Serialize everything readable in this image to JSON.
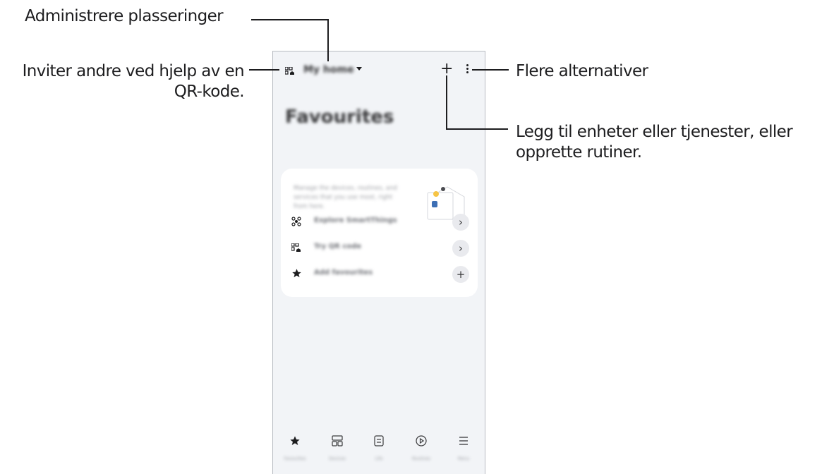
{
  "callouts": {
    "manage_locations": "Administrere plasseringer",
    "invite_line1": "Inviter andre ved hjelp av en",
    "invite_line2": "QR-kode.",
    "more_options": "Flere alternativer",
    "add_line1": "Legg til enheter eller tjenester, eller",
    "add_line2": "opprette rutiner."
  },
  "app": {
    "location_name": "My home",
    "page_title": "Favourites",
    "card_description": "Manage the devices, routines, and services that you use most, right from here.",
    "rows": [
      {
        "label": "Explore SmartThings",
        "icon": "smartthings-icon",
        "action": "chevron-right"
      },
      {
        "label": "Try QR code",
        "icon": "qr-home-icon",
        "action": "chevron-right"
      },
      {
        "label": "Add favourites",
        "icon": "star-plus-icon",
        "action": "plus"
      }
    ],
    "row_actions": {
      "chevron": "›",
      "plus": "+"
    },
    "nav": [
      {
        "label": "Favourites",
        "icon": "star-icon"
      },
      {
        "label": "Devices",
        "icon": "devices-icon"
      },
      {
        "label": "Life",
        "icon": "life-icon"
      },
      {
        "label": "Routines",
        "icon": "routines-icon"
      },
      {
        "label": "Menu",
        "icon": "menu-icon"
      }
    ],
    "top_plus": "+"
  },
  "colors": {
    "background": "#f2f4f7",
    "card": "#ffffff",
    "text": "#1d1d1f",
    "accent_yellow": "#f6c445"
  }
}
